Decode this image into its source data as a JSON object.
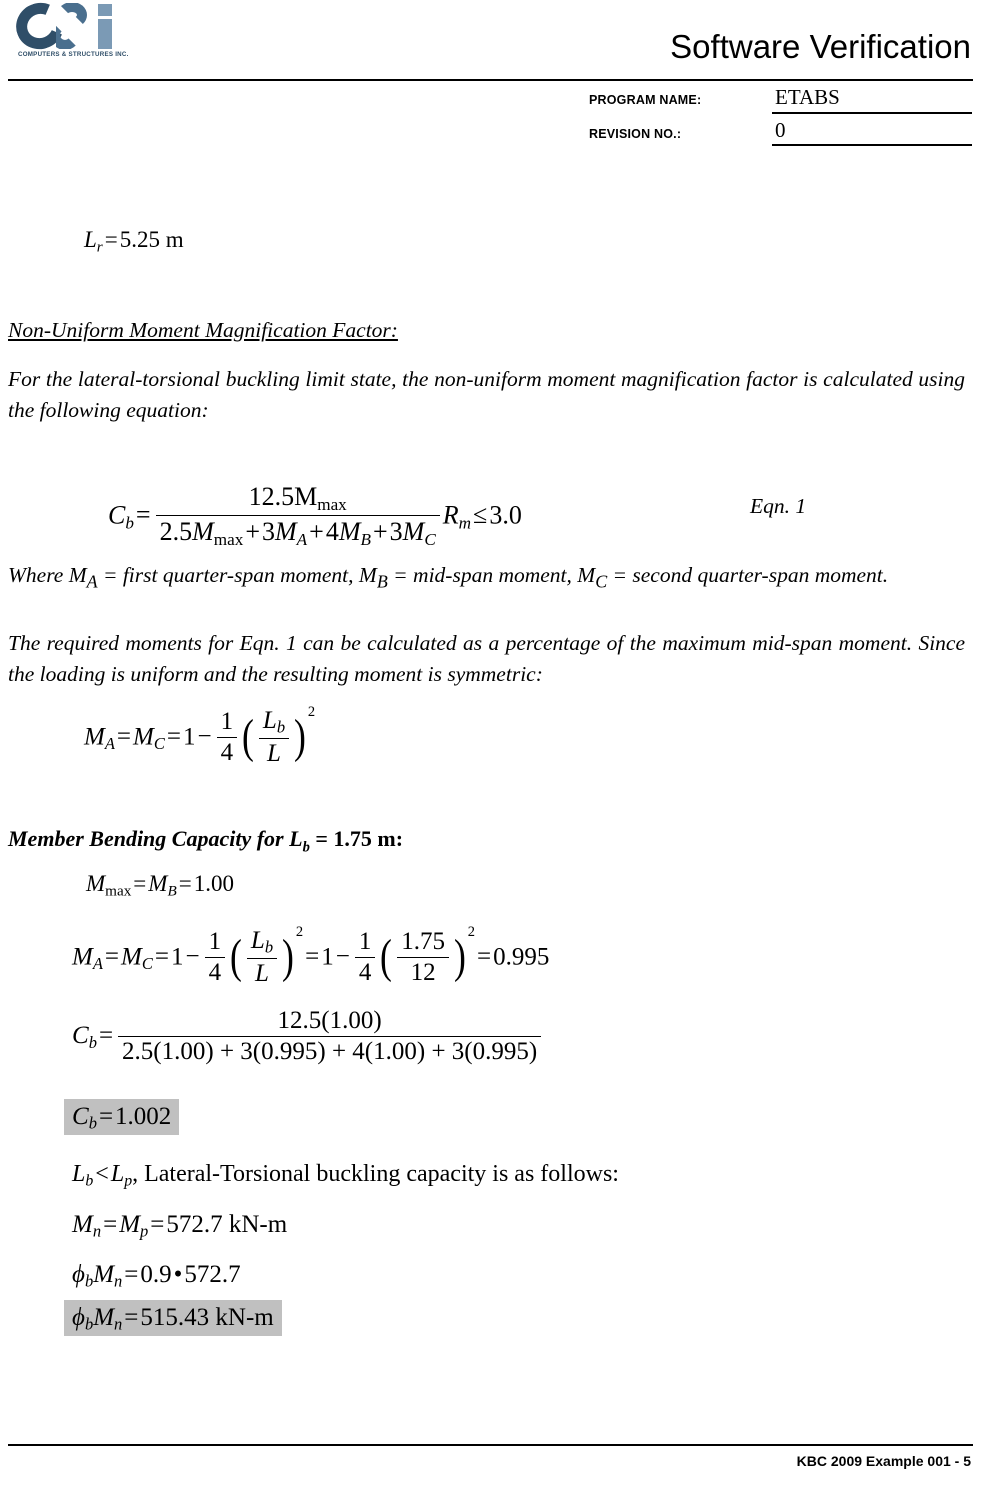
{
  "header": {
    "title": "Software Verification",
    "program_name_label": "PROGRAM NAME:",
    "program_name_value": "ETABS",
    "revision_label": "REVISION NO.:",
    "revision_value": "0",
    "logo_tagline": "COMPUTERS & STRUCTURES INC.",
    "logo_colors": {
      "dark": "#2f4e68",
      "mid": "#4a6f8e",
      "light": "#7b9ab5"
    }
  },
  "body": {
    "eq_lr": {
      "lhs_var": "L",
      "lhs_sub": "r",
      "eq": "=",
      "value": "5.25",
      "unit": "m"
    },
    "section_heading": "Non-Uniform Moment Magnification Factor:",
    "intro_paragraph": "For the lateral-torsional buckling limit state, the non-uniform moment magnification factor is calculated using the following equation:",
    "eqn1": {
      "lhs": "C",
      "lhs_sub": "b",
      "numerator": "12.5M",
      "numerator_sub": "max",
      "denominator_terms": [
        "2.5M",
        "max",
        "+ 3M",
        "A",
        "+ 4M",
        "B",
        "+ 3M",
        "C"
      ],
      "denominator_text": "2.5M max + 3M A + 4M B + 3M C",
      "rm": "R",
      "rm_sub": "m",
      "relation": "≤",
      "limit": "3.0",
      "tag": "Eqn. 1"
    },
    "where_paragraph": "Where MA = first quarter-span moment, MB = mid-span moment, MC = second quarter-span moment.",
    "required_paragraph": "The required moments for Eqn. 1 can be calculated as a percentage of the maximum mid-span moment. Since the loading is uniform and the resulting moment is symmetric:",
    "eq_ma_generic": {
      "lhs1": "M",
      "lhs1_sub": "A",
      "lhs2": "M",
      "lhs2_sub": "C",
      "one": "1",
      "minus": "−",
      "frac_num": "1",
      "frac_den": "4",
      "inner_num": "L",
      "inner_num_sub": "b",
      "inner_den": "L",
      "power": "2"
    },
    "member_heading": {
      "text_before": "Member Bending Capacity for ",
      "var": "L",
      "var_sub": "b",
      "text_after": " = 1.75 m:"
    },
    "eq_mmax": {
      "lhs": "M",
      "lhs_sub": "max",
      "mid": "M",
      "mid_sub": "B",
      "value": "1.00"
    },
    "eq_ma_numeric": {
      "lhs1": "M",
      "lhs1_sub": "A",
      "lhs2": "M",
      "lhs2_sub": "C",
      "one": "1",
      "frac_num": "1",
      "frac_den": "4",
      "inner_num": "L",
      "inner_num_sub": "b",
      "inner_den": "L",
      "power": "2",
      "num_inner_num": "1.75",
      "num_inner_den": "12",
      "result": "0.995"
    },
    "eq_cb_numeric": {
      "lhs": "C",
      "lhs_sub": "b",
      "numerator": "12.5(1.00)",
      "denominator": "2.5(1.00) + 3(0.995) + 4(1.00) + 3(0.995)"
    },
    "cb_result": {
      "lhs": "C",
      "lhs_sub": "b",
      "value": "1.002"
    },
    "lb_lp_line": {
      "lb": "L",
      "lb_sub": "b",
      "rel": "<",
      "lp": "L",
      "lp_sub": "p",
      "text": ", Lateral-Torsional buckling capacity is as follows:"
    },
    "eq_mn": {
      "lhs": "M",
      "lhs_sub": "n",
      "mid": "M",
      "mid_sub": "p",
      "value": "572.7",
      "unit": "kN-m"
    },
    "eq_phimn": {
      "phi": "ϕ",
      "phi_sub": "b",
      "m": "M",
      "m_sub": "n",
      "factor": "0.9",
      "dot": "•",
      "value": "572.7"
    },
    "phimn_result": {
      "phi": "ϕ",
      "phi_sub": "b",
      "m": "M",
      "m_sub": "n",
      "value": "515.43",
      "unit": "kN-m"
    }
  },
  "footer": {
    "text": "KBC 2009 Example 001 - 5"
  }
}
